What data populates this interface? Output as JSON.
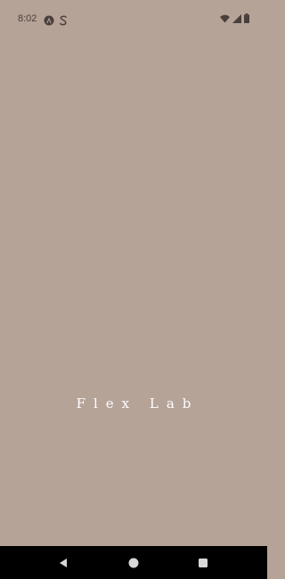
{
  "status_bar": {
    "time": "8:02",
    "left_icons": [
      "android-auto-icon",
      "s-app-icon"
    ],
    "right_icons": [
      "wifi-icon",
      "cell-signal-icon",
      "battery-icon"
    ]
  },
  "splash": {
    "title": "Flex Lab"
  },
  "nav_bar": {
    "buttons": [
      "back-icon",
      "home-icon",
      "recents-icon"
    ]
  },
  "colors": {
    "background": "#b5a398",
    "status_text": "#4a3f3a",
    "title_text": "#ffffff",
    "nav_background": "#000000"
  }
}
